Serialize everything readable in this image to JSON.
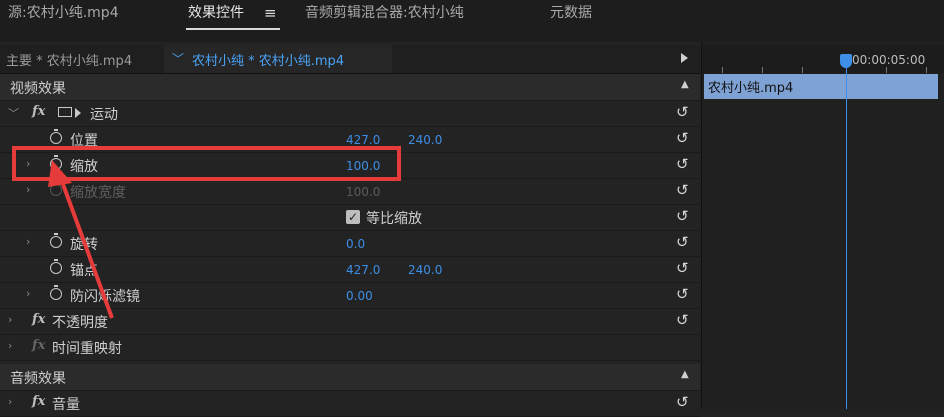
{
  "tabs": {
    "source": "源:农村小纯.mp4",
    "effect_controls": "效果控件",
    "audio_mixer": "音频剪辑混合器:农村小纯",
    "metadata": "元数据"
  },
  "sequence_bar": {
    "master": "主要 * 农村小纯.mp4",
    "clip": "农村小纯 * 农村小纯.mp4"
  },
  "sections": {
    "video_effects": "视频效果",
    "audio_effects": "音频效果"
  },
  "effects": {
    "fx_label": "fx",
    "motion": "运动",
    "position": {
      "label": "位置",
      "x": "427.0",
      "y": "240.0"
    },
    "scale": {
      "label": "缩放",
      "value": "100.0"
    },
    "scale_width": {
      "label": "缩放宽度",
      "value": "100.0"
    },
    "uniform_scale": {
      "label": "等比缩放",
      "checked": true
    },
    "rotation": {
      "label": "旋转",
      "value": "0.0"
    },
    "anchor": {
      "label": "锚点",
      "x": "427.0",
      "y": "240.0"
    },
    "anti_flicker": {
      "label": "防闪烁滤镜",
      "value": "0.00"
    },
    "opacity": "不透明度",
    "time_remap": "时间重映射",
    "volume": "音量"
  },
  "timeline": {
    "timecode": "00:00:05:00",
    "clip_name": "农村小纯.mp4"
  },
  "colors": {
    "accent": "#3d8ee5",
    "highlight": "#e53b3b",
    "clip": "#7fa2d4"
  }
}
